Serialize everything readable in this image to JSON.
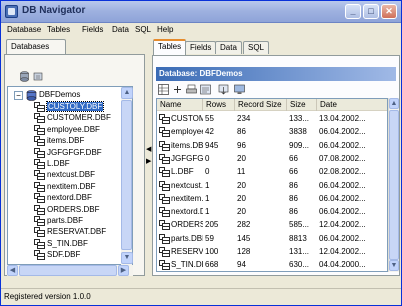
{
  "window": {
    "title": "DB Navigator"
  },
  "menu": [
    "Database",
    "Tables",
    "Fields",
    "Data",
    "SQL",
    "Help"
  ],
  "left_tab": "Databases",
  "tree": {
    "root": "DBFDemos",
    "expander": "−",
    "items": [
      {
        "label": "CUSTOLY.DBF",
        "state": "selected"
      },
      {
        "label": "CUSTOMER.DBF",
        "state": ""
      },
      {
        "label": "employee.DBF",
        "state": ""
      },
      {
        "label": "items.DBF",
        "state": ""
      },
      {
        "label": "JGFGFGF.DBF",
        "state": ""
      },
      {
        "label": "L.DBF",
        "state": ""
      },
      {
        "label": "nextcust.DBF",
        "state": ""
      },
      {
        "label": "nextitem.DBF",
        "state": ""
      },
      {
        "label": "nextord.DBF",
        "state": ""
      },
      {
        "label": "ORDERS.DBF",
        "state": ""
      },
      {
        "label": "parts.DBF",
        "state": ""
      },
      {
        "label": "RESERVAT.DBF",
        "state": ""
      },
      {
        "label": "S_TIN.DBF",
        "state": ""
      },
      {
        "label": "SDF.DBF",
        "state": ""
      }
    ]
  },
  "right_tabs": [
    "Tables",
    "Fields",
    "Data",
    "SQL"
  ],
  "database_header": "Database: DBFDemos",
  "grid": {
    "columns": [
      "Name",
      "Rows",
      "Record Size",
      "Size",
      "Date"
    ],
    "rows": [
      [
        "CUSTOM...",
        "55",
        "234",
        "133...",
        "13.04.2002..."
      ],
      [
        "employee....",
        "42",
        "86",
        "3838",
        "06.04.2002..."
      ],
      [
        "items.DBF",
        "945",
        "96",
        "909...",
        "06.04.2002..."
      ],
      [
        "JGFGFGF...",
        "0",
        "20",
        "66",
        "07.08.2002..."
      ],
      [
        "L.DBF",
        "0",
        "11",
        "66",
        "02.08.2002..."
      ],
      [
        "nextcust....",
        "1",
        "20",
        "86",
        "06.04.2002..."
      ],
      [
        "nextitem.D...",
        "1",
        "20",
        "86",
        "06.04.2002..."
      ],
      [
        "nextord.DBF",
        "1",
        "20",
        "86",
        "06.04.2002..."
      ],
      [
        "ORDERS....",
        "205",
        "282",
        "585...",
        "12.04.2002..."
      ],
      [
        "parts.DBF",
        "59",
        "145",
        "8813",
        "06.04.2002..."
      ],
      [
        "RESERV....",
        "100",
        "128",
        "131...",
        "12.04.2002..."
      ],
      [
        "S_TIN.DBF",
        "668",
        "94",
        "630...",
        "04.04.2000..."
      ]
    ]
  },
  "status": "Registered version 1.0.0",
  "colors": {
    "title_gradient_start": "#b8c8ec",
    "selection": "#316ac5",
    "tab_accent": "#e68b2c",
    "header_band": "#3a6bb5"
  }
}
